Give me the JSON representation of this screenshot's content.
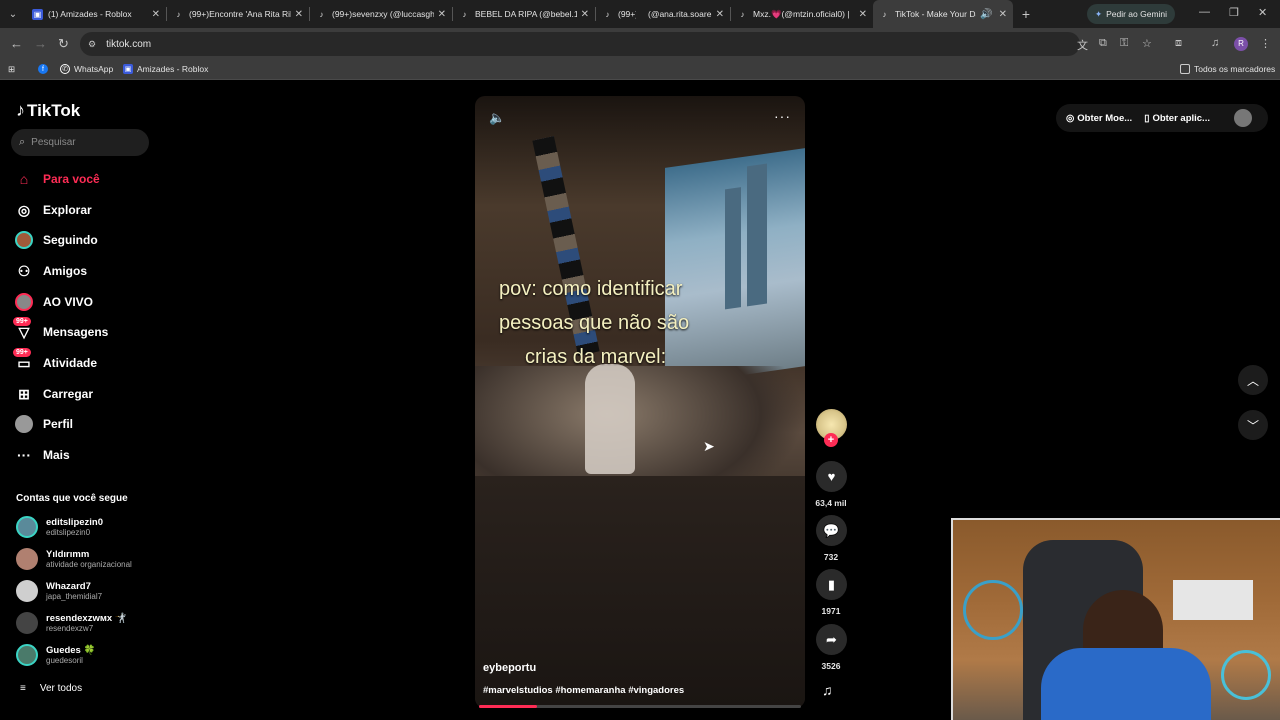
{
  "browser": {
    "tabs": [
      {
        "title": "(1) Amizades - Roblox",
        "icon": "roblox-icon"
      },
      {
        "title": "(99+)Encontre 'Ana Rita Rib",
        "icon": "tiktok-icon"
      },
      {
        "title": "(99+)sevenzxy (@luccasgh",
        "icon": "tiktok-icon"
      },
      {
        "title": "BEBEL DA RIPA (@bebel.16",
        "icon": "tiktok-icon"
      },
      {
        "title": "(99+)",
        "icon": "tiktok-icon"
      },
      {
        "title": "(@ana.rita.soare",
        "icon": "blank-icon"
      },
      {
        "title": "Mxz.💗(@mtzin.oficial0) |",
        "icon": "tiktok-icon"
      },
      {
        "title": "TikTok - Make Your Da",
        "icon": "tiktok-icon",
        "active": true
      }
    ],
    "gemini_label": "Pedir ao Gemini",
    "url": "tiktok.com",
    "bookmarks": [
      {
        "label": "",
        "icon": "facebook-icon"
      },
      {
        "label": "WhatsApp",
        "icon": "whatsapp-icon"
      },
      {
        "label": "Amizades - Roblox",
        "icon": "roblox-icon"
      }
    ],
    "all_bookmarks_label": "Todos os marcadores",
    "profile_initial": "R"
  },
  "tiktok": {
    "logo": "TikTok",
    "search_placeholder": "Pesquisar",
    "nav": [
      {
        "label": "Para você",
        "icon": "home-icon",
        "active": true
      },
      {
        "label": "Explorar",
        "icon": "compass-icon"
      },
      {
        "label": "Seguindo",
        "icon": "following-avatar-icon"
      },
      {
        "label": "Amigos",
        "icon": "friends-icon"
      },
      {
        "label": "AO VIVO",
        "icon": "live-icon"
      },
      {
        "label": "Mensagens",
        "icon": "messages-icon",
        "badge": "99+"
      },
      {
        "label": "Atividade",
        "icon": "activity-icon",
        "badge": "99+"
      },
      {
        "label": "Carregar",
        "icon": "upload-icon"
      },
      {
        "label": "Perfil",
        "icon": "profile-icon"
      },
      {
        "label": "Mais",
        "icon": "more-icon"
      }
    ],
    "following_header": "Contas que você segue",
    "following": [
      {
        "name": "editslipezin0",
        "user": "editslipezin0"
      },
      {
        "name": "Yıldırımm",
        "user": "atividade organizacional"
      },
      {
        "name": "Whazard7",
        "user": "japa_themidial7"
      },
      {
        "name": "resendexzwᴍx 🤺",
        "user": "resendexzw7"
      },
      {
        "name": "Guedes 🍀",
        "user": "guedesoril"
      }
    ],
    "see_all": "Ver todos",
    "video": {
      "caption_lines": [
        "pov: como identificar",
        "pessoas que não são",
        "crias da marvel:"
      ],
      "author": "eybeportu",
      "hashtags": "#marvelstudios #homemaranha #vingadores",
      "progress": 0.18
    },
    "actions": {
      "likes": "63,4 mil",
      "comments": "732",
      "saves": "1971",
      "shares": "3526"
    },
    "header": {
      "coins_label": "Obter Moe...",
      "app_label": "Obter aplic..."
    }
  }
}
